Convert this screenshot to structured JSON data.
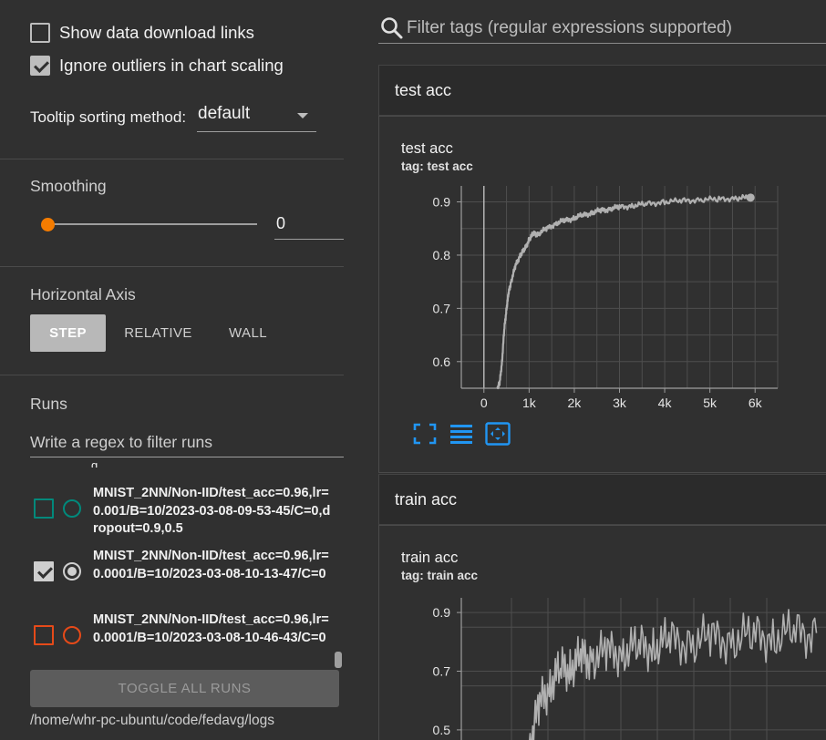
{
  "sidebar": {
    "show_download_links": {
      "label": "Show data download links",
      "checked": false
    },
    "ignore_outliers": {
      "label": "Ignore outliers in chart scaling",
      "checked": true
    },
    "tooltip_sorting": {
      "label": "Tooltip sorting method:",
      "value": "default"
    },
    "smoothing": {
      "title": "Smoothing",
      "value": "0"
    },
    "horizontal_axis": {
      "title": "Horizontal Axis",
      "options": [
        "STEP",
        "RELATIVE",
        "WALL"
      ],
      "selected": "STEP"
    },
    "runs": {
      "title": "Runs",
      "filter_placeholder": "Write a regex to filter runs",
      "partial_top_text": "g",
      "items": [
        {
          "label": "MNIST_2NN/Non-IID/test_acc=0.96,lr=0.001/B=10/2023-03-08-09-53-45/C=0,dropout=0.9,0.5",
          "checked": false,
          "color": "#00897b"
        },
        {
          "label": "MNIST_2NN/Non-IID/test_acc=0.96,lr=0.0001/B=10/2023-03-08-10-13-47/C=0",
          "checked": true,
          "color": "#cfcfcf"
        },
        {
          "label": "MNIST_2NN/Non-IID/test_acc=0.96,lr=0.0001/B=10/2023-03-08-10-46-43/C=0",
          "checked": false,
          "color": "#e64a19"
        }
      ]
    },
    "toggle_all_label": "TOGGLE ALL RUNS",
    "logdir": "/home/whr-pc-ubuntu/code/fedavg/logs"
  },
  "main": {
    "filter_placeholder": "Filter tags (regular expressions supported)",
    "accent_color": "#2196f3",
    "orange_accent": "#f57c00",
    "groups": [
      {
        "header": "test acc",
        "card_title": "test acc",
        "card_tag": "tag: test acc"
      },
      {
        "header": "train acc",
        "card_title": "train acc",
        "card_tag": "tag: train acc"
      }
    ],
    "tool_icons": [
      "fit-to-screen-icon",
      "toggle-y-log-icon",
      "fit-domain-icon"
    ]
  },
  "chart_data": [
    {
      "type": "line",
      "title": "test acc",
      "subtitle": "tag: test acc",
      "x_ticks": [
        "0",
        "1k",
        "2k",
        "3k",
        "4k",
        "5k",
        "6k"
      ],
      "y_ticks": [
        "0.6",
        "0.7",
        "0.8",
        "0.9"
      ],
      "xlim": [
        -500,
        6500
      ],
      "ylim": [
        0.55,
        0.93
      ],
      "grid": true,
      "series": [
        {
          "color": "#b0b0b0",
          "x": [
            300,
            350,
            400,
            450,
            500,
            550,
            600,
            700,
            800,
            900,
            1000,
            1100,
            1200,
            1400,
            1600,
            1800,
            2000,
            2200,
            2400,
            2600,
            2800,
            3000,
            3300,
            3600,
            4000,
            4400,
            4800,
            5200,
            5600,
            5900
          ],
          "y": [
            0.55,
            0.56,
            0.6,
            0.66,
            0.7,
            0.73,
            0.75,
            0.78,
            0.8,
            0.81,
            0.83,
            0.84,
            0.84,
            0.85,
            0.86,
            0.865,
            0.87,
            0.875,
            0.88,
            0.884,
            0.887,
            0.89,
            0.893,
            0.896,
            0.9,
            0.902,
            0.904,
            0.905,
            0.907,
            0.908
          ]
        }
      ]
    },
    {
      "type": "line",
      "title": "train acc",
      "subtitle": "tag: train acc",
      "y_ticks": [
        "0.5",
        "0.7",
        "0.9"
      ],
      "ylim": [
        0.45,
        0.95
      ],
      "grid": true,
      "series": [
        {
          "color": "#b0b0b0",
          "x": [
            300,
            500,
            700,
            900,
            1100,
            1300,
            1500,
            1800,
            2100,
            2400,
            2700,
            3000,
            3400,
            3800,
            4200,
            4600,
            5000,
            5400,
            5800
          ],
          "y": [
            0.45,
            0.58,
            0.66,
            0.7,
            0.72,
            0.74,
            0.75,
            0.76,
            0.77,
            0.78,
            0.79,
            0.8,
            0.8,
            0.81,
            0.81,
            0.82,
            0.82,
            0.83,
            0.83
          ]
        }
      ]
    }
  ]
}
